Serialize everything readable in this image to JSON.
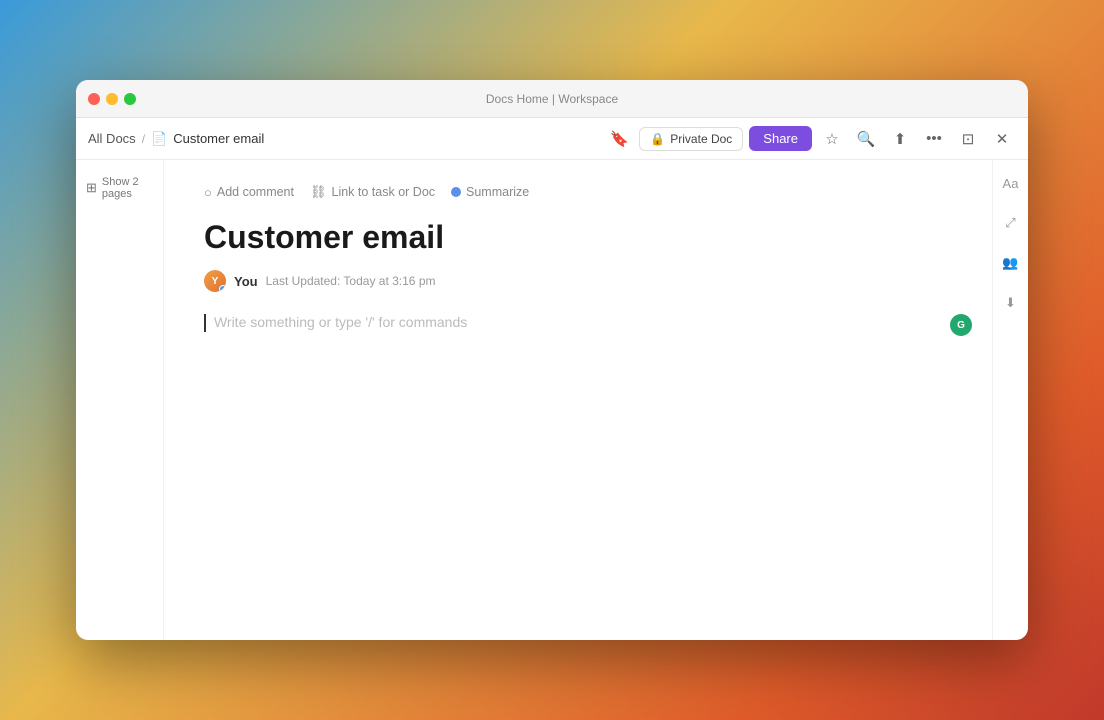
{
  "window": {
    "title": "Docs Home | Workspace"
  },
  "titlebar": {
    "title": "Docs Home | Workspace"
  },
  "breadcrumb": {
    "all_docs": "All Docs",
    "separator": "/",
    "current": "Customer email"
  },
  "toolbar": {
    "private_doc_label": "Private Doc",
    "share_label": "Share"
  },
  "left_sidebar": {
    "show_pages_label": "Show 2 pages"
  },
  "action_bar": {
    "add_comment": "Add comment",
    "link_to_task": "Link to task or Doc",
    "summarize": "Summarize"
  },
  "document": {
    "title": "Customer email",
    "author": "You",
    "last_updated": "Last Updated: Today at 3:16 pm",
    "content_placeholder": "Write something or type '/' for commands"
  },
  "right_sidebar": {
    "icons": [
      "format-text-icon",
      "expand-icon",
      "users-icon",
      "download-icon"
    ]
  }
}
